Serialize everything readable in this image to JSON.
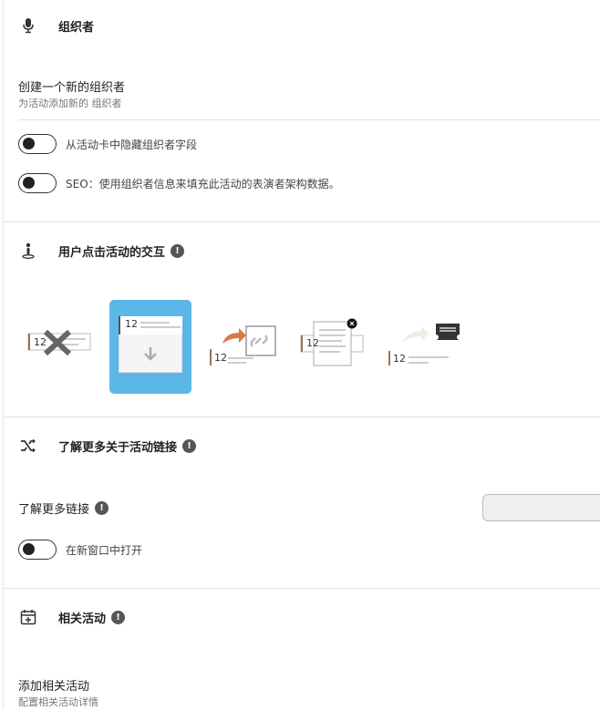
{
  "organizer": {
    "title": "组织者",
    "create_label": "创建一个新的组织者",
    "create_sub": "为活动添加新的 组织者",
    "toggles": [
      {
        "label": "从活动卡中隐藏组织者字段",
        "on": false
      },
      {
        "label": "SEO：使用组织者信息来填充此活动的表演者架构数据。",
        "on": false
      }
    ]
  },
  "interaction": {
    "title": "用户点击活动的交互",
    "info_icon": "!",
    "option_number": "12",
    "selected_index": 1
  },
  "learn_more": {
    "title": "了解更多关于活动链接",
    "info_icon": "!",
    "link_label": "了解更多链接",
    "link_value": "",
    "toggle_label": "在新窗口中打开",
    "toggle_on": false
  },
  "related": {
    "title": "相关活动",
    "info_icon": "!",
    "add_label": "添加相关活动",
    "add_sub": "配置相关活动详情"
  },
  "colors": {
    "selected_bg": "#5bb8e6",
    "accent_arrow": "#d9774a",
    "accent_bar": "#a07050"
  }
}
